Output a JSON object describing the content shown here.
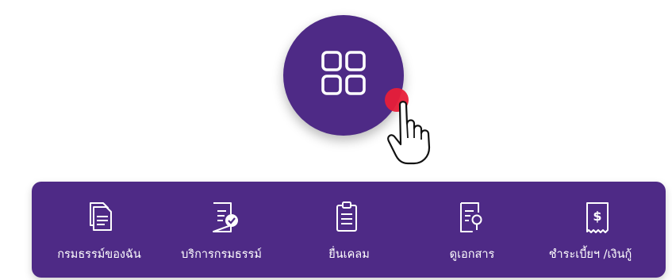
{
  "hero": {
    "icon": "grid-apps-icon",
    "cursor_icon": "hand-pointer-icon"
  },
  "colors": {
    "primary": "#4e2a86",
    "accent": "#e81e38",
    "text": "#ffffff"
  },
  "nav": {
    "items": [
      {
        "label": "กรมธรรม์ของฉัน",
        "icon": "documents-icon"
      },
      {
        "label": "บริการกรมธรรม์",
        "icon": "document-check-icon"
      },
      {
        "label": "ยื่นเคลม",
        "icon": "clipboard-icon"
      },
      {
        "label": "ดูเอกสาร",
        "icon": "document-search-icon"
      },
      {
        "label": "ชำระเบี้ยฯ /เงินกู้",
        "icon": "receipt-dollar-icon"
      }
    ]
  }
}
